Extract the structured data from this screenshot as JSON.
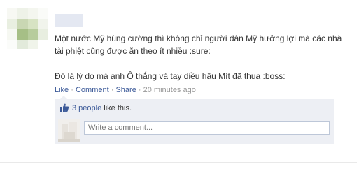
{
  "post": {
    "message_lines": [
      "Một nước Mỹ hùng cường thì không chỉ người dân Mỹ hưởng lợi mà các nhà tài phiệt cũng được ăn theo ít nhiều :sure:",
      "Đó là lý do mà anh Ô thắng và tay diều hâu Mít đã thua :boss:"
    ],
    "actions": {
      "like_label": "Like",
      "comment_label": "Comment",
      "share_label": "Share",
      "separator": "·",
      "timestamp": "20 minutes ago"
    }
  },
  "likes": {
    "icon": "thumbs-up-icon",
    "count_label": "3 people",
    "suffix": " like this."
  },
  "comment": {
    "placeholder": "Write a comment..."
  },
  "colors": {
    "link": "#3b5998",
    "muted": "#999999",
    "panel_bg": "#edeff4",
    "input_border": "#bdc7d8",
    "avatar_tiles": [
      "#f4f6ef",
      "#d7e3c3",
      "#a6bf86",
      "#c9d7b3",
      "#eef2e8"
    ]
  }
}
